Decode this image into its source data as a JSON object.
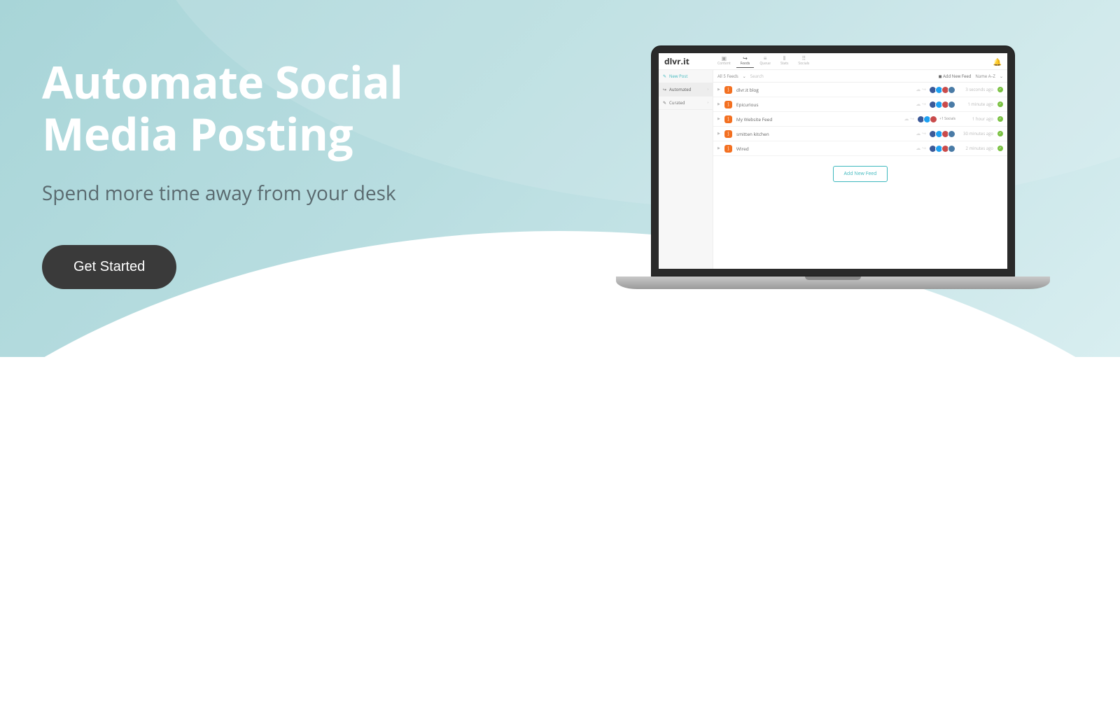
{
  "hero": {
    "title_line1": "Automate Social",
    "title_line2": "Media Posting",
    "subtitle": "Spend more time away from your desk",
    "cta": "Get Started"
  },
  "app": {
    "logo": "dlvr.it",
    "nav": [
      {
        "label": "Content",
        "icon": "▣"
      },
      {
        "label": "Feeds",
        "icon": "↪"
      },
      {
        "label": "Queue",
        "icon": "≡"
      },
      {
        "label": "Stats",
        "icon": "⫴"
      },
      {
        "label": "Socials",
        "icon": "⠿"
      }
    ],
    "sidebar": {
      "new_post": "New Post",
      "items": [
        {
          "label": "Automated",
          "icon": "↪"
        },
        {
          "label": "Curated",
          "icon": "✎"
        }
      ]
    },
    "toolbar": {
      "filter": "All 5 Feeds",
      "search_placeholder": "Search",
      "add_feed": "Add New Feed",
      "sort": "Name A–Z"
    },
    "feeds": [
      {
        "name": "dlvr.it blog",
        "time": "3 seconds ago",
        "extra": ""
      },
      {
        "name": "Epicurious",
        "time": "1 minute ago",
        "extra": ""
      },
      {
        "name": "My Website Feed",
        "time": "1 hour ago",
        "extra": "+1 Socials"
      },
      {
        "name": "smitten kitchen",
        "time": "30 minutes ago",
        "extra": ""
      },
      {
        "name": "Wired",
        "time": "2 minutes ago",
        "extra": ""
      }
    ],
    "add_feed_btn": "Add New Feed"
  }
}
